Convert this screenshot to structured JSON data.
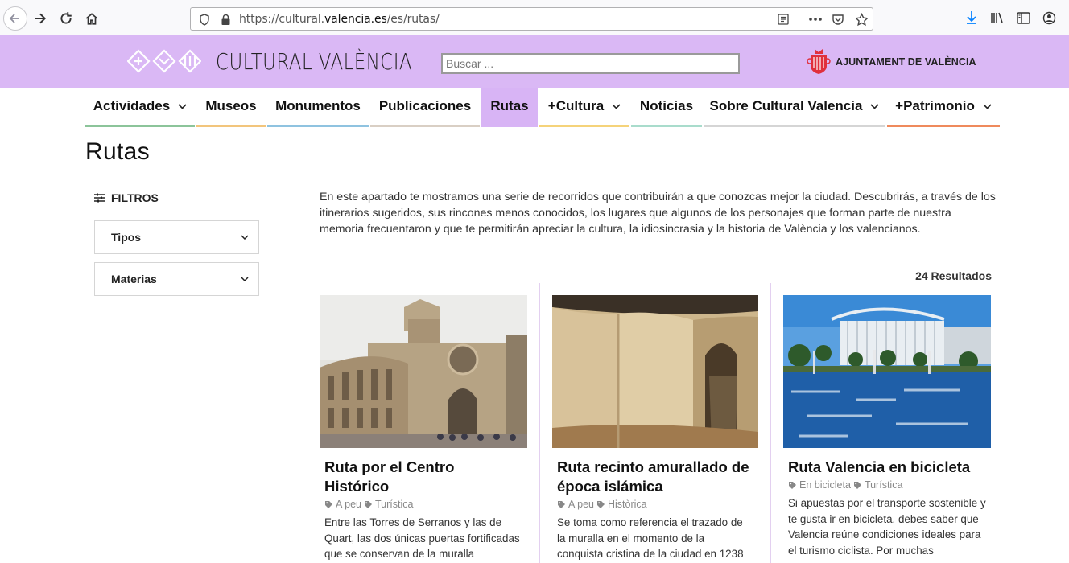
{
  "browser": {
    "url_prefix": "https://cultural.",
    "url_domain": "valencia.es",
    "url_suffix": "/es/rutas/"
  },
  "header": {
    "logo_text": "CULTURAL VALÈNCIA",
    "search_placeholder": "Buscar ...",
    "ayuntamiento": "AJUNTAMENT DE VALÈNCIA"
  },
  "nav": {
    "items": [
      {
        "label": "Actividades",
        "dropdown": true,
        "color": "#8cc49a"
      },
      {
        "label": "Museos",
        "dropdown": false,
        "color": "#f2c57c"
      },
      {
        "label": "Monumentos",
        "dropdown": false,
        "color": "#8fc3e0"
      },
      {
        "label": "Publicaciones",
        "dropdown": false,
        "color": "#d9cfc4"
      },
      {
        "label": "Rutas",
        "dropdown": false,
        "active": true,
        "color": "#d8b4f5"
      },
      {
        "label": "+Cultura",
        "dropdown": true,
        "color": "#f5d37a"
      },
      {
        "label": "Noticias",
        "dropdown": false,
        "color": "#a9dccc"
      },
      {
        "label": "Sobre Cultural Valencia",
        "dropdown": true,
        "color": "#d5d5d5"
      },
      {
        "label": "+Patrimonio",
        "dropdown": true,
        "color": "#ef8a5c"
      }
    ]
  },
  "page": {
    "title": "Rutas",
    "filters_label": "FILTROS",
    "filters": [
      "Tipos",
      "Materias"
    ],
    "intro": "En este apartado te mostramos una serie de recorridos que contribuirán a que conozcas mejor la ciudad. Descubrirás, a través de los itinerarios sugeridos, sus rincones menos conocidos, los lugares que algunos de los personajes que forman parte de nuestra memoria frecuentaron y que te permitirán apreciar la cultura, la idiosincrasia y la historia de València y los valencianos.",
    "results": "24 Resultados"
  },
  "cards": [
    {
      "title": "Ruta por el Centro Histórico",
      "tags": [
        "A peu",
        "Turística"
      ],
      "desc": "Entre las Torres de Serranos y las de Quart, las dos únicas puertas fortificadas que se conservan de la muralla medieval, transcurre nuestra"
    },
    {
      "title": "Ruta recinto amurallado de época islámica",
      "tags": [
        "A peu",
        "Històrica"
      ],
      "desc": "Se toma como referencia el trazado de la muralla en el momento de la conquista cristina de la ciudad en 1238"
    },
    {
      "title": "Ruta Valencia en bicicleta",
      "tags": [
        "En bicicleta",
        "Turística"
      ],
      "desc": "Si apuestas por el transporte sostenible y te gusta ir en bicicleta, debes saber que Valencia reúne condiciones ideales para el turismo ciclista. Por muchas"
    }
  ],
  "colors": {
    "brand_purple": "#dab8f5",
    "active_tab": "#d8b4f5"
  }
}
